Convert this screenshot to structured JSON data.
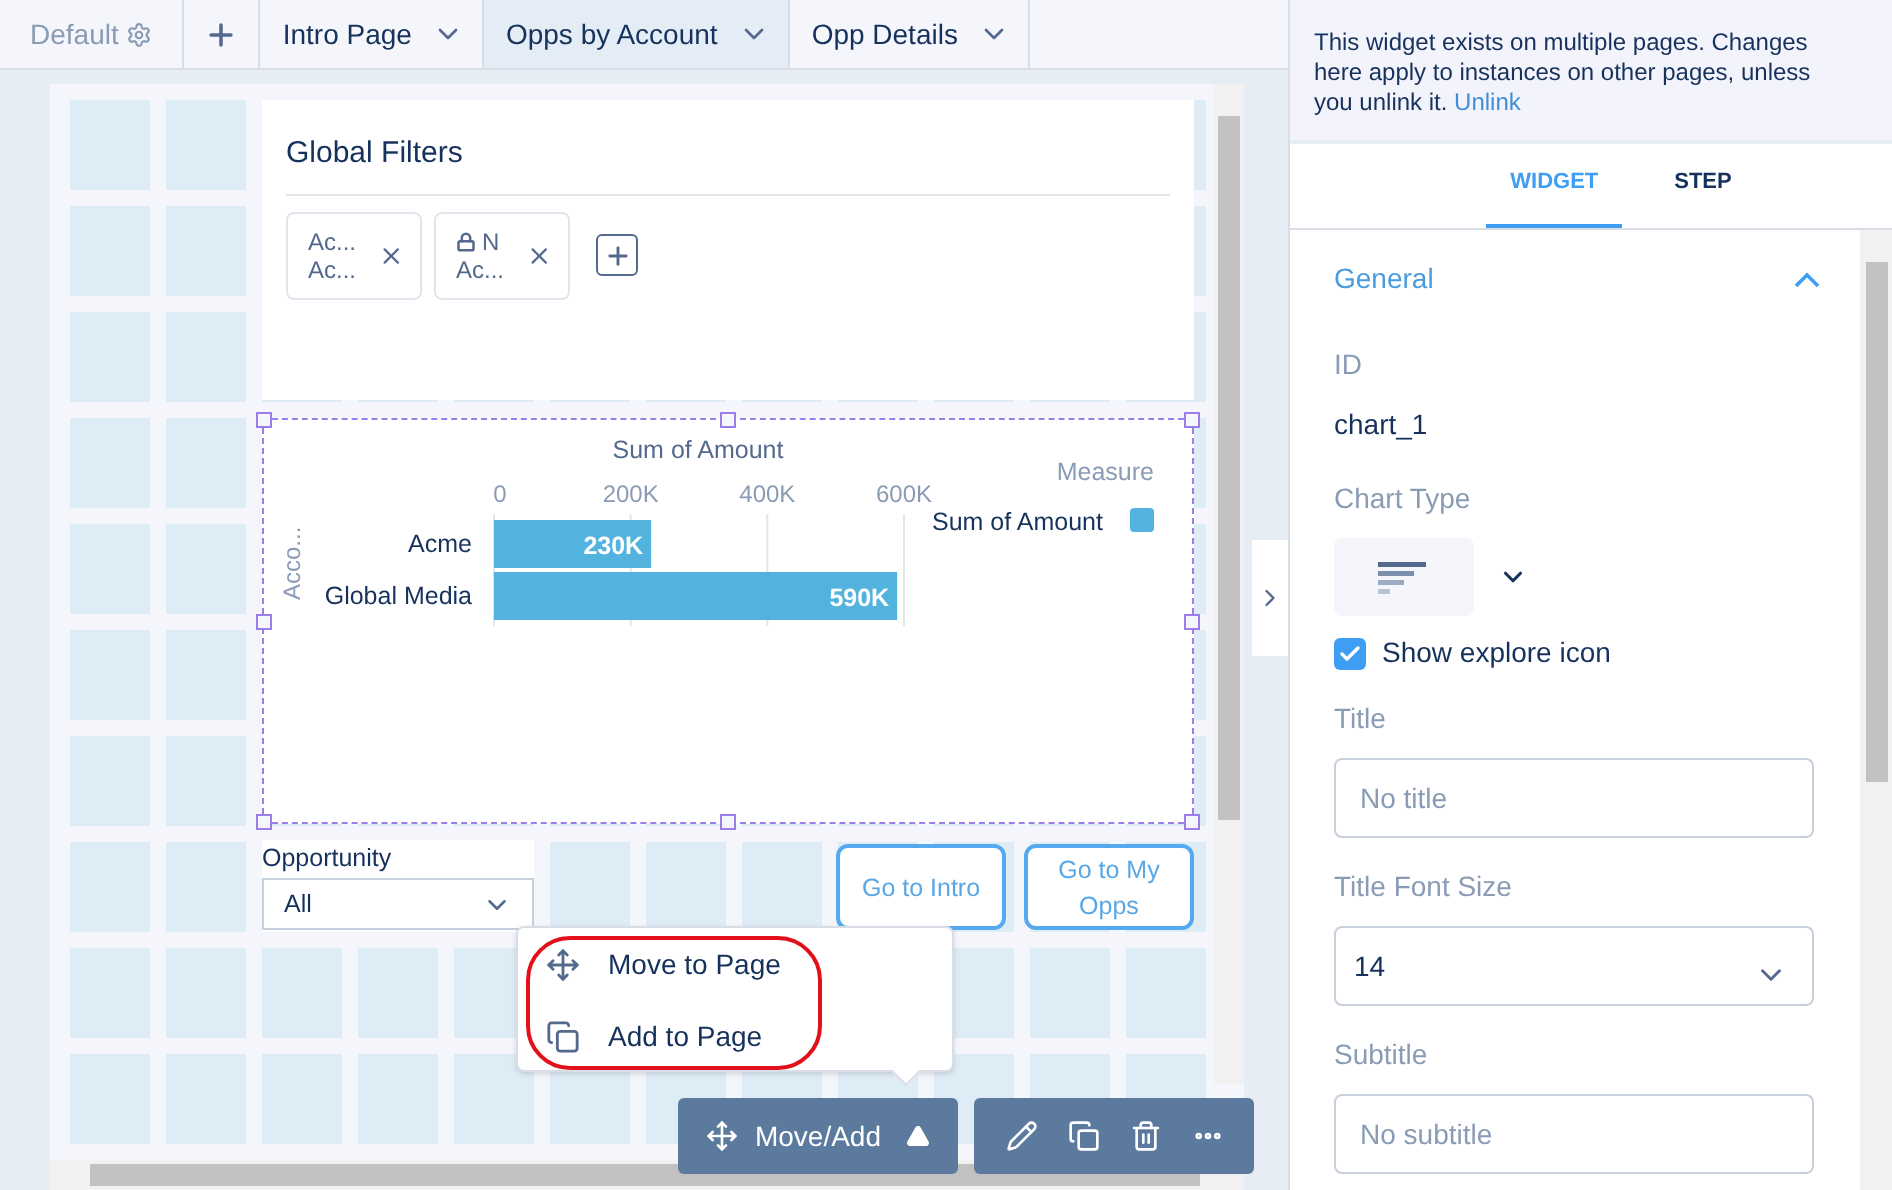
{
  "page_tabs": [
    {
      "kind": "default",
      "label": "Default",
      "selected": false
    },
    {
      "kind": "add",
      "selected": false
    },
    {
      "kind": "page",
      "label": "Intro Page",
      "selected": false
    },
    {
      "kind": "page",
      "label": "Opps by Account",
      "selected": true
    },
    {
      "kind": "page",
      "label": "Opp Details",
      "selected": false
    }
  ],
  "global_filters": {
    "title": "Global Filters",
    "filters": [
      {
        "locked": false,
        "lines": [
          "Ac...",
          "Ac..."
        ]
      },
      {
        "locked": true,
        "lines": [
          "N",
          "Ac..."
        ]
      }
    ]
  },
  "chart": {
    "selected": true,
    "legend_title": "Measure",
    "chart_data": {
      "type": "bar",
      "orientation": "horizontal",
      "xlabel": "Sum of Amount",
      "ylabel": "Acco...",
      "categories": [
        "Acme",
        "Global Media"
      ],
      "xlim": [
        0,
        600000
      ],
      "xticks": [
        {
          "value": 0,
          "label": "0"
        },
        {
          "value": 200000,
          "label": "200K"
        },
        {
          "value": 400000,
          "label": "400K"
        },
        {
          "value": 600000,
          "label": "600K"
        }
      ],
      "series": [
        {
          "name": "Sum of Amount",
          "color": "#52b4de",
          "values": [
            230000,
            590000
          ]
        }
      ],
      "value_labels": [
        "230K",
        "590K"
      ]
    }
  },
  "list_selector": {
    "label": "Opportunity",
    "value": "All"
  },
  "link_buttons": [
    "Go to Intro",
    "Go to My Opps"
  ],
  "popover": {
    "highlighted": true,
    "items": [
      {
        "kind": "move",
        "label": "Move to Page"
      },
      {
        "kind": "add",
        "label": "Add to Page"
      }
    ]
  },
  "toolbar": {
    "move_add": "Move/Add",
    "actions": [
      {
        "kind": "edit"
      },
      {
        "kind": "copy"
      },
      {
        "kind": "delete"
      },
      {
        "kind": "more"
      }
    ]
  },
  "notice": {
    "text": "This widget exists on multiple pages. Changes here apply to instances on other pages, unless you unlink it.",
    "link": "Unlink"
  },
  "panel_tabs": [
    {
      "label": "WIDGET",
      "selected": true
    },
    {
      "label": "STEP",
      "selected": false
    }
  ],
  "section": {
    "title": "General",
    "expanded": true
  },
  "fields": [
    {
      "kind": "text",
      "label": "ID",
      "value": "chart_1"
    },
    {
      "kind": "chart_type",
      "label": "Chart Type"
    },
    {
      "kind": "checkbox",
      "label": "Show explore icon",
      "checked": true
    },
    {
      "kind": "input",
      "label": "Title",
      "placeholder": "No title"
    },
    {
      "kind": "select",
      "label": "Title Font Size",
      "value": "14"
    },
    {
      "kind": "input",
      "label": "Subtitle",
      "placeholder": "No subtitle"
    }
  ]
}
